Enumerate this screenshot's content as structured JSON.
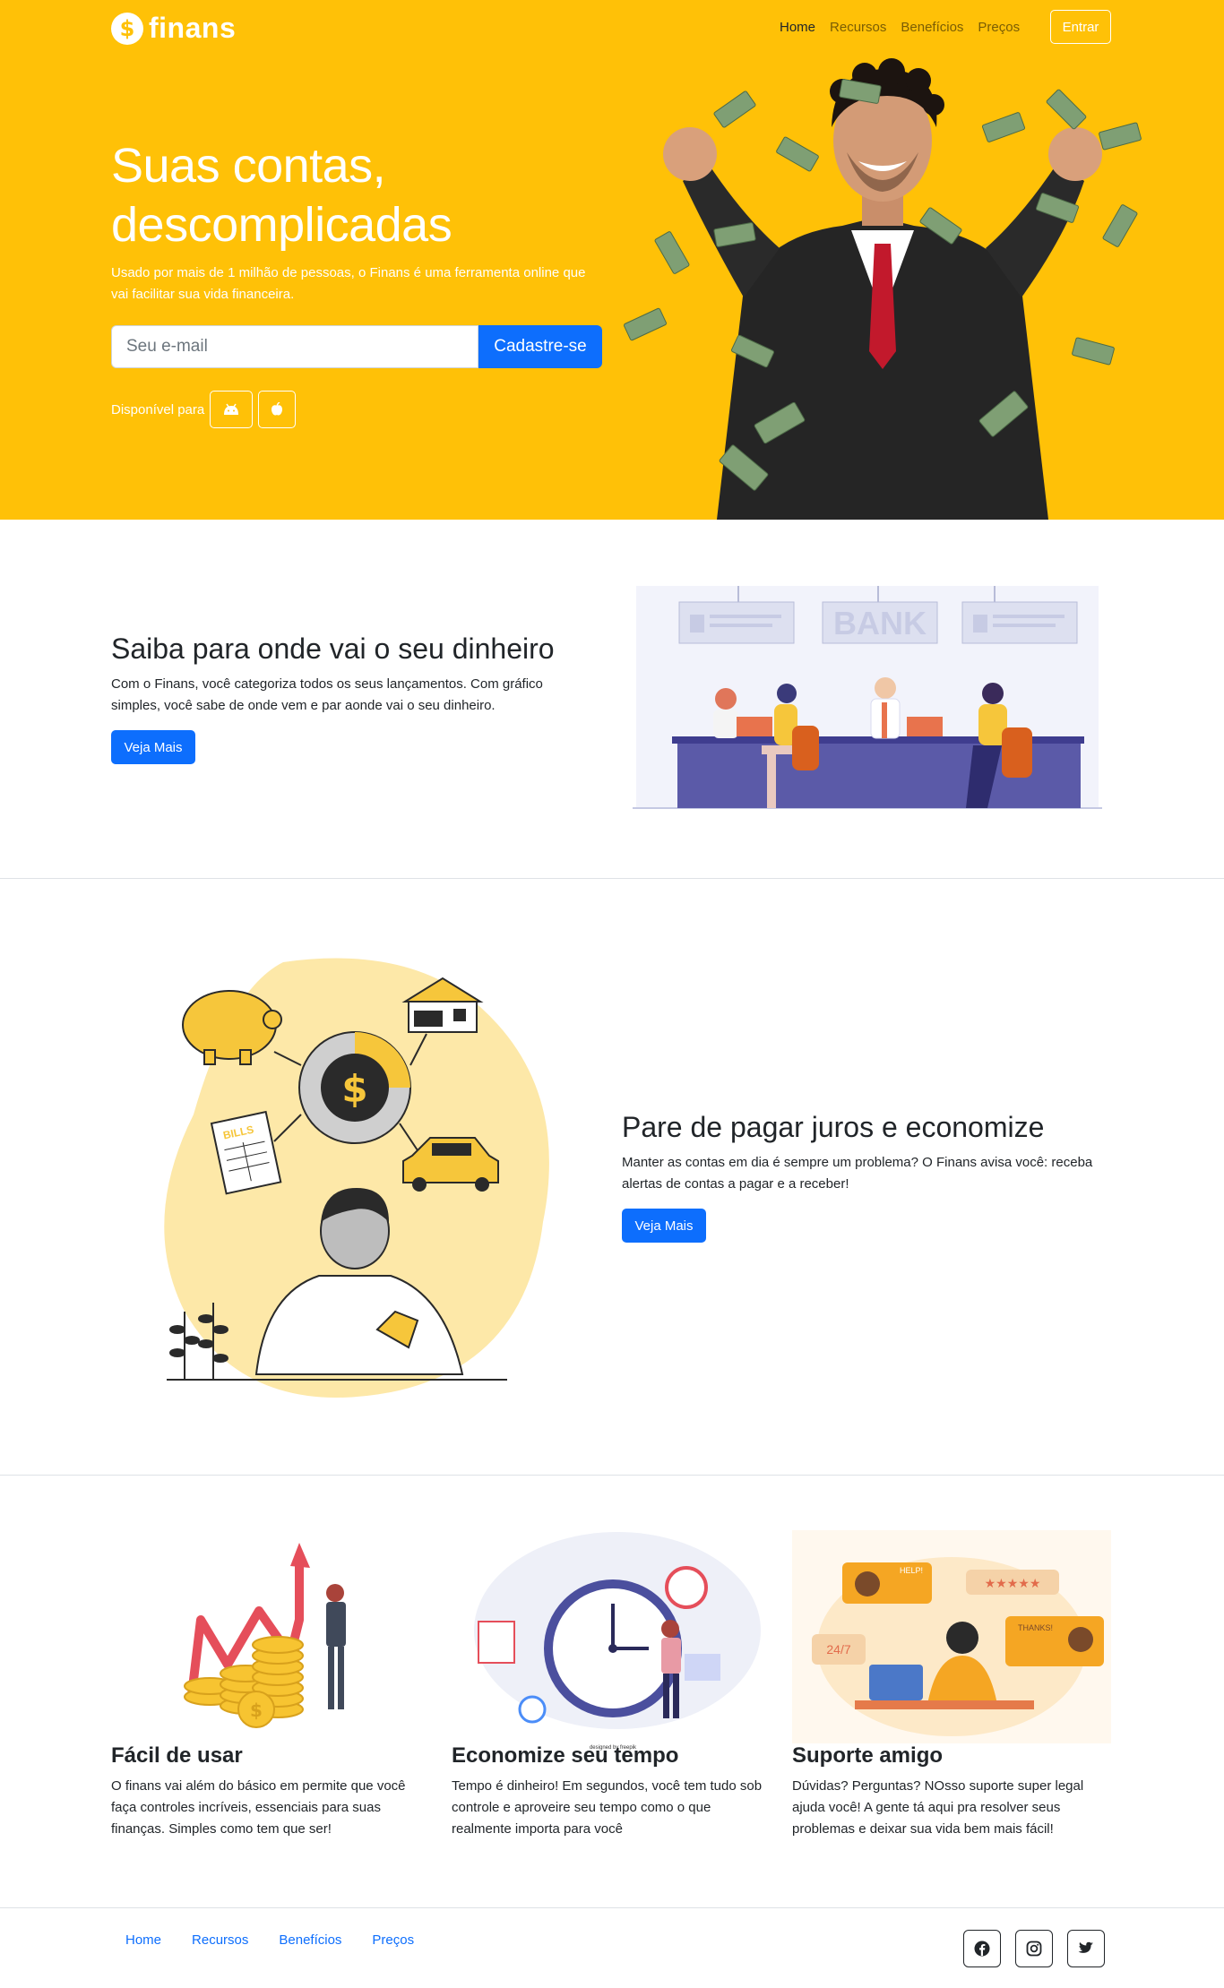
{
  "nav": {
    "brand": "finans",
    "links": [
      "Home",
      "Recursos",
      "Benefícios",
      "Preços"
    ],
    "login_label": "Entrar"
  },
  "hero": {
    "title_line1": "Suas contas,",
    "title_line2": "descomplicadas",
    "subtitle": "Usado por mais de 1 milhão de pessoas, o Finans é uma ferramenta online que vai facilitar sua vida financeira.",
    "email_placeholder": "Seu e-mail",
    "signup_label": "Cadastre-se",
    "available_label": "Disponível para"
  },
  "section1": {
    "title": "Saiba para onde vai o seu dinheiro",
    "text": "Com o Finans, você categoriza todos os seus lançamentos. Com gráfico simples, você sabe de onde vem e par aonde vai o seu dinheiro.",
    "button_label": "Veja Mais",
    "illustration_sign": "BANK"
  },
  "section2": {
    "title": "Pare de pagar juros e economize",
    "text": "Manter as contas em dia é sempre um problema? O Finans avisa você: receba alertas de contas a pagar e a receber!",
    "button_label": "Veja Mais",
    "illustration_labels": {
      "bills": "BILLS",
      "currency": "$"
    }
  },
  "features": [
    {
      "title": "Fácil de usar",
      "text": "O finans vai além do básico em permite que você faça controles incríveis, essenciais para suas finanças. Simples como tem que ser!"
    },
    {
      "title": "Economize seu tempo",
      "text": "Tempo é dinheiro! Em segundos, você tem tudo sob controle e aproveire seu tempo como o que realmente importa para você"
    },
    {
      "title": "Suporte amigo",
      "text": "Dúvidas? Perguntas? NOsso suporte super legal ajuda você! A gente tá aqui pra resolver seus problemas e deixar sua vida bem mais fácil!"
    }
  ],
  "feature_illustration_labels": {
    "credit": "designed by freepik",
    "help": "HELP!",
    "thanks": "THANKS!",
    "hours": "24/7"
  },
  "footer": {
    "links": [
      "Home",
      "Recursos",
      "Benefícios",
      "Preços"
    ],
    "social_icons": [
      "facebook-icon",
      "instagram-icon",
      "twitter-icon"
    ]
  },
  "colors": {
    "brand_yellow": "#ffc107",
    "primary_blue": "#0d6efd"
  }
}
